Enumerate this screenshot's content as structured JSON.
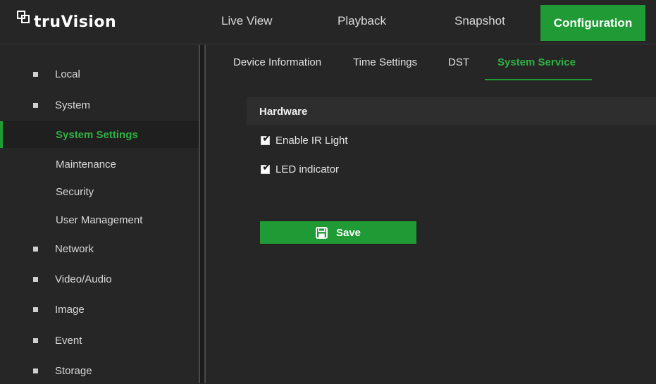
{
  "brand": {
    "name": "truVision"
  },
  "topnav": {
    "tabs": [
      {
        "label": "Live View"
      },
      {
        "label": "Playback"
      },
      {
        "label": "Snapshot"
      },
      {
        "label": "Configuration",
        "active": true
      }
    ]
  },
  "sidebar": {
    "items": [
      {
        "label": "Local",
        "type": "group"
      },
      {
        "label": "System",
        "type": "group"
      },
      {
        "label": "System Settings",
        "type": "sub",
        "active": true
      },
      {
        "label": "Maintenance",
        "type": "sub"
      },
      {
        "label": "Security",
        "type": "sub"
      },
      {
        "label": "User Management",
        "type": "sub"
      },
      {
        "label": "Network",
        "type": "group"
      },
      {
        "label": "Video/Audio",
        "type": "group"
      },
      {
        "label": "Image",
        "type": "group"
      },
      {
        "label": "Event",
        "type": "group"
      },
      {
        "label": "Storage",
        "type": "group"
      }
    ]
  },
  "subtabs": [
    {
      "label": "Device Information"
    },
    {
      "label": "Time Settings"
    },
    {
      "label": "DST"
    },
    {
      "label": "System Service",
      "active": true
    }
  ],
  "hardware": {
    "title": "Hardware",
    "options": [
      {
        "label": "Enable IR Light",
        "checked": true
      },
      {
        "label": "LED indicator",
        "checked": true
      }
    ]
  },
  "actions": {
    "save_label": "Save"
  },
  "colors": {
    "accent": "#1f9a34",
    "accent_text": "#2fb243",
    "background": "#262626"
  },
  "icons": {
    "brand": "truvision-logo-icon",
    "save": "floppy-disk-icon",
    "checkbox": "checkmark-icon",
    "bullet": "square-bullet-icon"
  }
}
